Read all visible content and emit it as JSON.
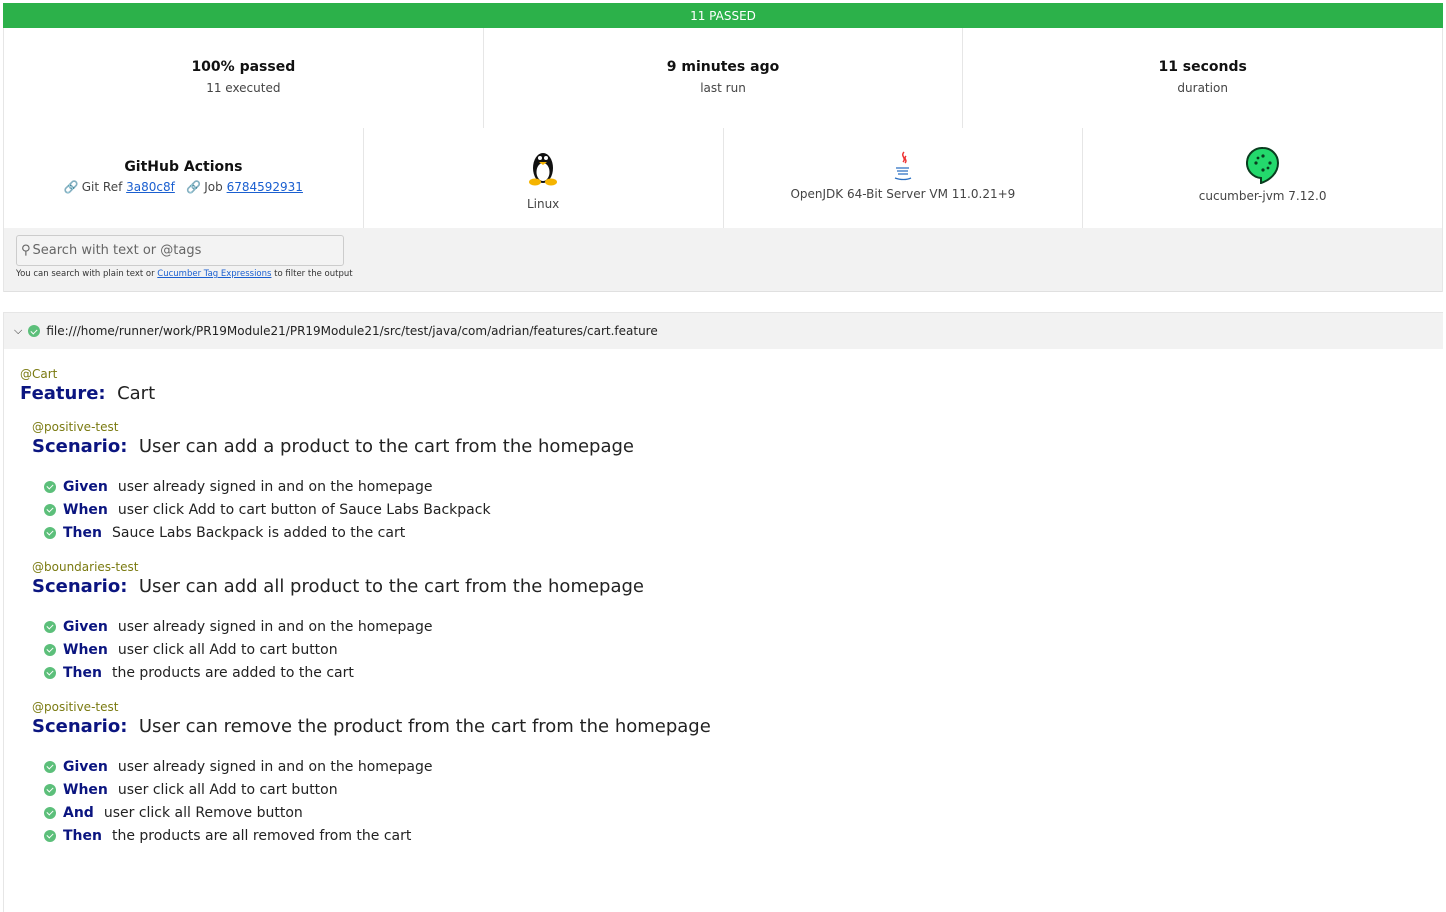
{
  "banner": "11 PASSED",
  "stats": [
    {
      "value": "100% passed",
      "label": "11 executed"
    },
    {
      "value": "9 minutes ago",
      "label": "last run"
    },
    {
      "value": "11 seconds",
      "label": "duration"
    }
  ],
  "ci": {
    "name": "GitHub Actions",
    "git_ref_label": "Git Ref",
    "git_ref": "3a80c8f",
    "job_label": "Job",
    "job": "6784592931"
  },
  "env": {
    "os": "Linux",
    "runtime": "OpenJDK 64-Bit Server VM 11.0.21+9",
    "implementation": "cucumber-jvm 7.12.0"
  },
  "search": {
    "placeholder": "Search with text or @tags",
    "hint_pre": "You can search with plain text or",
    "hint_link": "Cucumber Tag Expressions",
    "hint_post": "to filter the output"
  },
  "feature": {
    "path": "file:///home/runner/work/PR19Module21/PR19Module21/src/test/java/com/adrian/features/cart.feature",
    "tag": "@Cart",
    "keyword": "Feature:",
    "name": "Cart",
    "scenarios": [
      {
        "tag": "@positive-test",
        "keyword": "Scenario:",
        "name": "User can add a product to the cart from the homepage",
        "steps": [
          {
            "kw": "Given",
            "text": "user already signed in and on the homepage"
          },
          {
            "kw": "When",
            "text": "user click Add to cart button of Sauce Labs Backpack"
          },
          {
            "kw": "Then",
            "text": "Sauce Labs Backpack is added to the cart"
          }
        ]
      },
      {
        "tag": "@boundaries-test",
        "keyword": "Scenario:",
        "name": "User can add all product to the cart from the homepage",
        "steps": [
          {
            "kw": "Given",
            "text": "user already signed in and on the homepage"
          },
          {
            "kw": "When",
            "text": "user click all Add to cart button"
          },
          {
            "kw": "Then",
            "text": "the products are added to the cart"
          }
        ]
      },
      {
        "tag": "@positive-test",
        "keyword": "Scenario:",
        "name": "User can remove the product from the cart from the homepage",
        "steps": [
          {
            "kw": "Given",
            "text": "user already signed in and on the homepage"
          },
          {
            "kw": "When",
            "text": "user click all Add to cart button"
          },
          {
            "kw": "And",
            "text": "user click all Remove button"
          },
          {
            "kw": "Then",
            "text": "the products are all removed from the cart"
          }
        ]
      }
    ]
  },
  "colors": {
    "passed": "#2cb14a",
    "keyword": "#0b1580",
    "tag": "#7a7a10"
  }
}
